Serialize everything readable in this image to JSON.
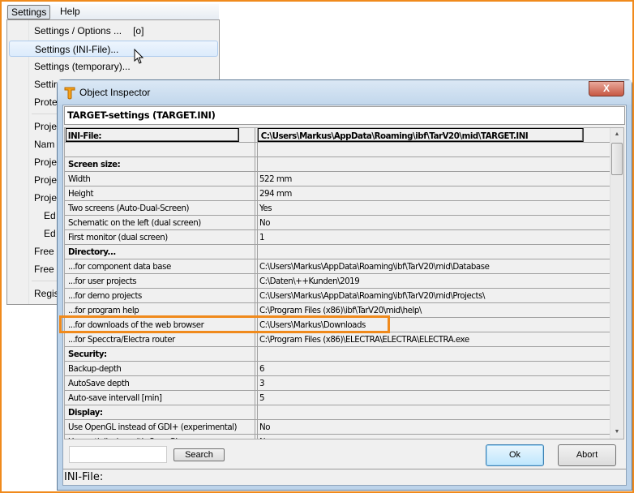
{
  "menubar": {
    "items": [
      "Settings",
      "Help"
    ]
  },
  "dropdown": {
    "items": [
      {
        "label": "Settings / Options ...",
        "shortcut": "[o]"
      },
      {
        "label": "Settings (INI-File)...",
        "highlighted": true
      },
      {
        "label": "Settings (temporary)..."
      },
      {
        "label": "Settir"
      },
      {
        "label": "Prote"
      },
      {
        "label": "Proje"
      },
      {
        "label": "Nam"
      },
      {
        "label": "Proje"
      },
      {
        "label": "Proje"
      },
      {
        "label": "Proje"
      },
      {
        "label": "Ed"
      },
      {
        "label": "Ed"
      },
      {
        "label": "Free"
      },
      {
        "label": "Free"
      },
      {
        "label": "Regis"
      }
    ]
  },
  "dialog": {
    "title": "Object Inspector",
    "close_label": "X",
    "header": "TARGET-settings (TARGET.INI)",
    "rows": [
      {
        "name": "INI-File:",
        "value": "C:\\Users\\Markus\\AppData\\Roaming\\ibf\\TarV20\\mid\\TARGET.INI",
        "type": "first"
      },
      {
        "name": "",
        "value": ""
      },
      {
        "name": "Screen size:",
        "value": "",
        "type": "sec"
      },
      {
        "name": "Width",
        "value": "522 mm"
      },
      {
        "name": "Height",
        "value": "294 mm"
      },
      {
        "name": "Two screens (Auto-Dual-Screen)",
        "value": "Yes"
      },
      {
        "name": "Schematic on the left (dual screen)",
        "value": "No"
      },
      {
        "name": "First monitor (dual screen)",
        "value": "1"
      },
      {
        "name": "Directory...",
        "value": "",
        "type": "sec"
      },
      {
        "name": "...for component data base",
        "value": "C:\\Users\\Markus\\AppData\\Roaming\\ibf\\TarV20\\mid\\Database"
      },
      {
        "name": "...for user projects",
        "value": "C:\\Daten\\++Kunden\\2019"
      },
      {
        "name": "...for demo projects",
        "value": "C:\\Users\\Markus\\AppData\\Roaming\\ibf\\TarV20\\mid\\Projects\\"
      },
      {
        "name": "...for program help",
        "value": "C:\\Program Files (x86)\\ibf\\TarV20\\mid\\help\\"
      },
      {
        "name": "...for downloads of the web browser",
        "value": "C:\\Users\\Markus\\Downloads"
      },
      {
        "name": "...for Specctra/Electra router",
        "value": "C:\\Program Files (x86)\\ELECTRA\\ELECTRA\\ELECTRA.exe"
      },
      {
        "name": "Security:",
        "value": "",
        "type": "sec"
      },
      {
        "name": "Backup-depth",
        "value": "6"
      },
      {
        "name": "AutoSave depth",
        "value": "3"
      },
      {
        "name": "Auto-save intervall [min]",
        "value": "5"
      },
      {
        "name": "Display:",
        "value": "",
        "type": "sec"
      },
      {
        "name": "Use OpenGL instead of GDI+ (experimental)",
        "value": "No"
      },
      {
        "name": "Use antialiasing with OpenGL",
        "value": "No"
      }
    ],
    "search": {
      "value": "",
      "button": "Search"
    },
    "ok": "Ok",
    "abort": "Abort",
    "status": "INI-File:"
  },
  "colors": {
    "highlight": "#f08a1c",
    "frame": "#f08a1c"
  }
}
